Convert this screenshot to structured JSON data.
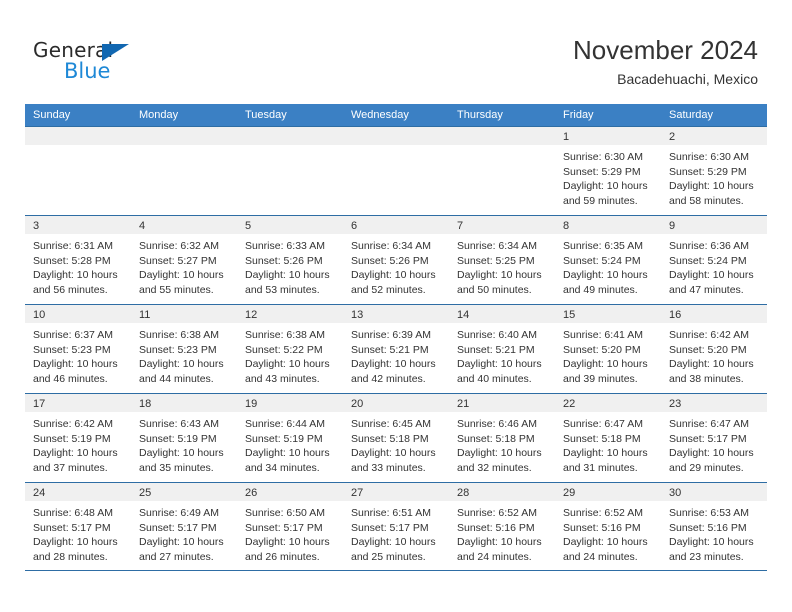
{
  "brand": {
    "name_part1": "General",
    "name_part2": "Blue",
    "accent_color": "#1e88d6",
    "triangle_color": "#1167b1"
  },
  "header": {
    "month_title": "November 2024",
    "location": "Bacadehuachi, Mexico",
    "weekday_header_color": "#3b80c4"
  },
  "calendar": {
    "weekdays": [
      "Sunday",
      "Monday",
      "Tuesday",
      "Wednesday",
      "Thursday",
      "Friday",
      "Saturday"
    ],
    "weeks": [
      [
        {
          "day": "",
          "lines": []
        },
        {
          "day": "",
          "lines": []
        },
        {
          "day": "",
          "lines": []
        },
        {
          "day": "",
          "lines": []
        },
        {
          "day": "",
          "lines": []
        },
        {
          "day": "1",
          "lines": [
            "Sunrise: 6:30 AM",
            "Sunset: 5:29 PM",
            "Daylight: 10 hours and 59 minutes."
          ]
        },
        {
          "day": "2",
          "lines": [
            "Sunrise: 6:30 AM",
            "Sunset: 5:29 PM",
            "Daylight: 10 hours and 58 minutes."
          ]
        }
      ],
      [
        {
          "day": "3",
          "lines": [
            "Sunrise: 6:31 AM",
            "Sunset: 5:28 PM",
            "Daylight: 10 hours and 56 minutes."
          ]
        },
        {
          "day": "4",
          "lines": [
            "Sunrise: 6:32 AM",
            "Sunset: 5:27 PM",
            "Daylight: 10 hours and 55 minutes."
          ]
        },
        {
          "day": "5",
          "lines": [
            "Sunrise: 6:33 AM",
            "Sunset: 5:26 PM",
            "Daylight: 10 hours and 53 minutes."
          ]
        },
        {
          "day": "6",
          "lines": [
            "Sunrise: 6:34 AM",
            "Sunset: 5:26 PM",
            "Daylight: 10 hours and 52 minutes."
          ]
        },
        {
          "day": "7",
          "lines": [
            "Sunrise: 6:34 AM",
            "Sunset: 5:25 PM",
            "Daylight: 10 hours and 50 minutes."
          ]
        },
        {
          "day": "8",
          "lines": [
            "Sunrise: 6:35 AM",
            "Sunset: 5:24 PM",
            "Daylight: 10 hours and 49 minutes."
          ]
        },
        {
          "day": "9",
          "lines": [
            "Sunrise: 6:36 AM",
            "Sunset: 5:24 PM",
            "Daylight: 10 hours and 47 minutes."
          ]
        }
      ],
      [
        {
          "day": "10",
          "lines": [
            "Sunrise: 6:37 AM",
            "Sunset: 5:23 PM",
            "Daylight: 10 hours and 46 minutes."
          ]
        },
        {
          "day": "11",
          "lines": [
            "Sunrise: 6:38 AM",
            "Sunset: 5:23 PM",
            "Daylight: 10 hours and 44 minutes."
          ]
        },
        {
          "day": "12",
          "lines": [
            "Sunrise: 6:38 AM",
            "Sunset: 5:22 PM",
            "Daylight: 10 hours and 43 minutes."
          ]
        },
        {
          "day": "13",
          "lines": [
            "Sunrise: 6:39 AM",
            "Sunset: 5:21 PM",
            "Daylight: 10 hours and 42 minutes."
          ]
        },
        {
          "day": "14",
          "lines": [
            "Sunrise: 6:40 AM",
            "Sunset: 5:21 PM",
            "Daylight: 10 hours and 40 minutes."
          ]
        },
        {
          "day": "15",
          "lines": [
            "Sunrise: 6:41 AM",
            "Sunset: 5:20 PM",
            "Daylight: 10 hours and 39 minutes."
          ]
        },
        {
          "day": "16",
          "lines": [
            "Sunrise: 6:42 AM",
            "Sunset: 5:20 PM",
            "Daylight: 10 hours and 38 minutes."
          ]
        }
      ],
      [
        {
          "day": "17",
          "lines": [
            "Sunrise: 6:42 AM",
            "Sunset: 5:19 PM",
            "Daylight: 10 hours and 37 minutes."
          ]
        },
        {
          "day": "18",
          "lines": [
            "Sunrise: 6:43 AM",
            "Sunset: 5:19 PM",
            "Daylight: 10 hours and 35 minutes."
          ]
        },
        {
          "day": "19",
          "lines": [
            "Sunrise: 6:44 AM",
            "Sunset: 5:19 PM",
            "Daylight: 10 hours and 34 minutes."
          ]
        },
        {
          "day": "20",
          "lines": [
            "Sunrise: 6:45 AM",
            "Sunset: 5:18 PM",
            "Daylight: 10 hours and 33 minutes."
          ]
        },
        {
          "day": "21",
          "lines": [
            "Sunrise: 6:46 AM",
            "Sunset: 5:18 PM",
            "Daylight: 10 hours and 32 minutes."
          ]
        },
        {
          "day": "22",
          "lines": [
            "Sunrise: 6:47 AM",
            "Sunset: 5:18 PM",
            "Daylight: 10 hours and 31 minutes."
          ]
        },
        {
          "day": "23",
          "lines": [
            "Sunrise: 6:47 AM",
            "Sunset: 5:17 PM",
            "Daylight: 10 hours and 29 minutes."
          ]
        }
      ],
      [
        {
          "day": "24",
          "lines": [
            "Sunrise: 6:48 AM",
            "Sunset: 5:17 PM",
            "Daylight: 10 hours and 28 minutes."
          ]
        },
        {
          "day": "25",
          "lines": [
            "Sunrise: 6:49 AM",
            "Sunset: 5:17 PM",
            "Daylight: 10 hours and 27 minutes."
          ]
        },
        {
          "day": "26",
          "lines": [
            "Sunrise: 6:50 AM",
            "Sunset: 5:17 PM",
            "Daylight: 10 hours and 26 minutes."
          ]
        },
        {
          "day": "27",
          "lines": [
            "Sunrise: 6:51 AM",
            "Sunset: 5:17 PM",
            "Daylight: 10 hours and 25 minutes."
          ]
        },
        {
          "day": "28",
          "lines": [
            "Sunrise: 6:52 AM",
            "Sunset: 5:16 PM",
            "Daylight: 10 hours and 24 minutes."
          ]
        },
        {
          "day": "29",
          "lines": [
            "Sunrise: 6:52 AM",
            "Sunset: 5:16 PM",
            "Daylight: 10 hours and 24 minutes."
          ]
        },
        {
          "day": "30",
          "lines": [
            "Sunrise: 6:53 AM",
            "Sunset: 5:16 PM",
            "Daylight: 10 hours and 23 minutes."
          ]
        }
      ]
    ]
  }
}
